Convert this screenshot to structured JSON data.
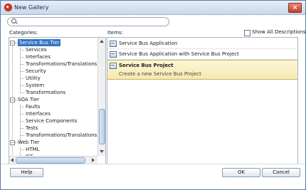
{
  "window": {
    "title": "New Gallery"
  },
  "search": {
    "value": "",
    "placeholder": ""
  },
  "labels": {
    "categories": "Categories:",
    "items": "Items:",
    "show_all": "Show All Descriptions"
  },
  "categories": [
    {
      "label": "Service Bus Tier",
      "depth": 0,
      "expander": "−",
      "selected": true
    },
    {
      "label": "Services",
      "depth": 1
    },
    {
      "label": "Interfaces",
      "depth": 1
    },
    {
      "label": "Transformations/Translations",
      "depth": 1
    },
    {
      "label": "Security",
      "depth": 1
    },
    {
      "label": "Utility",
      "depth": 1
    },
    {
      "label": "System",
      "depth": 1
    },
    {
      "label": "Transformations",
      "depth": 1
    },
    {
      "label": "SOA Tier",
      "depth": 0,
      "expander": "−"
    },
    {
      "label": "Faults",
      "depth": 1
    },
    {
      "label": "Interfaces",
      "depth": 1
    },
    {
      "label": "Service Components",
      "depth": 1
    },
    {
      "label": "Tests",
      "depth": 1
    },
    {
      "label": "Transformations/Translations",
      "depth": 1
    },
    {
      "label": "Web Tier",
      "depth": 0,
      "expander": "−"
    },
    {
      "label": "HTML",
      "depth": 1
    },
    {
      "label": "JSF",
      "depth": 1
    }
  ],
  "items": [
    {
      "label": "Service Bus Application"
    },
    {
      "label": "Service Bus Application with Service Bus Project"
    },
    {
      "label": "Service Bus Project",
      "selected": true,
      "description": "Create a new Service Bus Project"
    }
  ],
  "buttons": {
    "help": "Help",
    "ok": "OK",
    "cancel": "Cancel"
  },
  "colors": {
    "selection": "#3574c4",
    "item_highlight": "#f6e9b0",
    "close": "#c2402a"
  }
}
